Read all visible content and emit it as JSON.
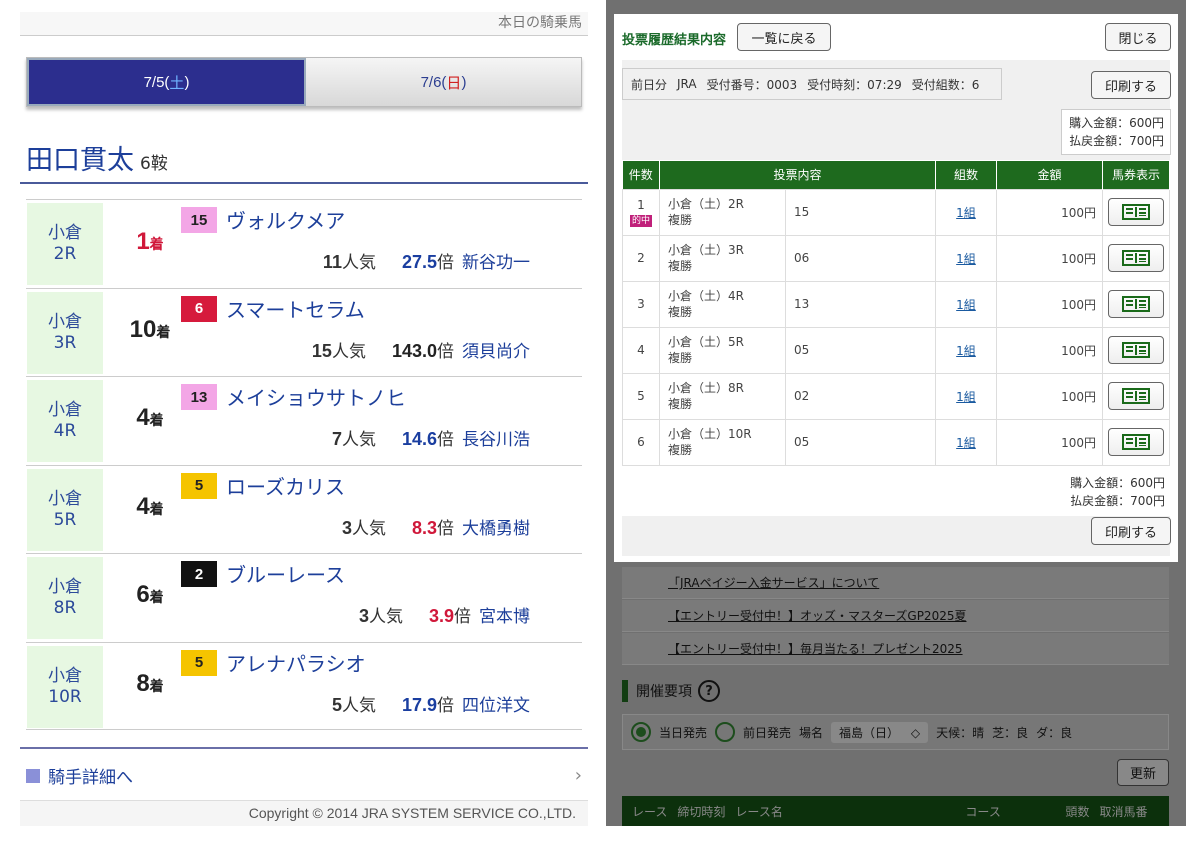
{
  "left": {
    "header_link": "本日の騎乗馬",
    "tabs": [
      {
        "date": "7/5(",
        "dow": "土",
        "close": ")",
        "active": true
      },
      {
        "date": "7/6(",
        "dow": "日",
        "close": ")",
        "active": false
      }
    ],
    "jockey": {
      "name": "田口貫太",
      "rides": "6鞍"
    },
    "races": [
      {
        "venue": "小倉",
        "race": "2R",
        "place": "1",
        "unit": "着",
        "num": "15",
        "num_bg": "#f3a6e6",
        "num_fg": "#222",
        "horse": "ヴォルクメア",
        "pop": "11",
        "pop_unit": "人気",
        "odds": "27.5",
        "odds_unit": "倍",
        "odds_color": "blue",
        "jockey": "新谷功一"
      },
      {
        "venue": "小倉",
        "race": "3R",
        "place": "10",
        "unit": "着",
        "num": "6",
        "num_bg": "#d61a3c",
        "num_fg": "#fff",
        "horse": "スマートセラム",
        "pop": "15",
        "pop_unit": "人気",
        "odds": "143.0",
        "odds_unit": "倍",
        "odds_color": "black",
        "jockey": "須貝尚介"
      },
      {
        "venue": "小倉",
        "race": "4R",
        "place": "4",
        "unit": "着",
        "num": "13",
        "num_bg": "#f3a6e6",
        "num_fg": "#222",
        "horse": "メイショウサトノヒ",
        "pop": "7",
        "pop_unit": "人気",
        "odds": "14.6",
        "odds_unit": "倍",
        "odds_color": "blue",
        "jockey": "長谷川浩"
      },
      {
        "venue": "小倉",
        "race": "5R",
        "place": "4",
        "unit": "着",
        "num": "5",
        "num_bg": "#f5c400",
        "num_fg": "#222",
        "horse": "ローズカリス",
        "pop": "3",
        "pop_unit": "人気",
        "odds": "8.3",
        "odds_unit": "倍",
        "odds_color": "red",
        "jockey": "大橋勇樹"
      },
      {
        "venue": "小倉",
        "race": "8R",
        "place": "6",
        "unit": "着",
        "num": "2",
        "num_bg": "#111111",
        "num_fg": "#fff",
        "horse": "ブルーレース",
        "pop": "3",
        "pop_unit": "人気",
        "odds": "3.9",
        "odds_unit": "倍",
        "odds_color": "red",
        "jockey": "宮本博"
      },
      {
        "venue": "小倉",
        "race": "10R",
        "place": "8",
        "unit": "着",
        "num": "5",
        "num_bg": "#f5c400",
        "num_fg": "#222",
        "horse": "アレナパラシオ",
        "pop": "5",
        "pop_unit": "人気",
        "odds": "17.9",
        "odds_unit": "倍",
        "odds_color": "blue",
        "jockey": "四位洋文"
      }
    ],
    "detail_link": "騎手詳細へ",
    "copyright": "Copyright © 2014 JRA SYSTEM SERVICE CO.,LTD."
  },
  "modal": {
    "title": "投票履歴結果内容",
    "back_label": "一覧に戻る",
    "close_label": "閉じる",
    "receipt": {
      "day": "前日分",
      "org": "JRA",
      "receipt_no": "受付番号：0003",
      "time": "受付時刻：07:29",
      "sets": "受付組数：6"
    },
    "print_label": "印刷する",
    "purchase": "購入金額：600円",
    "refund": "払戻金額：700円",
    "headers": [
      "件数",
      "投票内容",
      "組数",
      "金額",
      "馬券表示"
    ],
    "hit_label": "的中",
    "rows": [
      {
        "n": "1",
        "race": "小倉（土）2R",
        "type": "複勝",
        "pick": "15",
        "sets": "1組",
        "amount": "100円",
        "hit": true
      },
      {
        "n": "2",
        "race": "小倉（土）3R",
        "type": "複勝",
        "pick": "06",
        "sets": "1組",
        "amount": "100円",
        "hit": false
      },
      {
        "n": "3",
        "race": "小倉（土）4R",
        "type": "複勝",
        "pick": "13",
        "sets": "1組",
        "amount": "100円",
        "hit": false
      },
      {
        "n": "4",
        "race": "小倉（土）5R",
        "type": "複勝",
        "pick": "05",
        "sets": "1組",
        "amount": "100円",
        "hit": false
      },
      {
        "n": "5",
        "race": "小倉（土）8R",
        "type": "複勝",
        "pick": "02",
        "sets": "1組",
        "amount": "100円",
        "hit": false
      },
      {
        "n": "6",
        "race": "小倉（土）10R",
        "type": "複勝",
        "pick": "05",
        "sets": "1組",
        "amount": "100円",
        "hit": false
      }
    ]
  },
  "background": {
    "news": [
      "「JRAペイジー入金サービス」について",
      "【エントリー受付中！】オッズ・マスターズGP2025夏",
      "【エントリー受付中！】毎月当たる！プレゼント2025"
    ],
    "heading": "開催要項",
    "help": "?",
    "filter": {
      "today": "当日発売",
      "prev": "前日発売",
      "venue_label": "場名",
      "venue_value": "福島（日）",
      "weather": "天候：晴",
      "turf": "芝：良",
      "dirt": "ダ：良"
    },
    "refresh_label": "更新",
    "table_headers": [
      "レース",
      "締切時刻",
      "レース名",
      "コース",
      "頭数",
      "取消馬番"
    ]
  }
}
